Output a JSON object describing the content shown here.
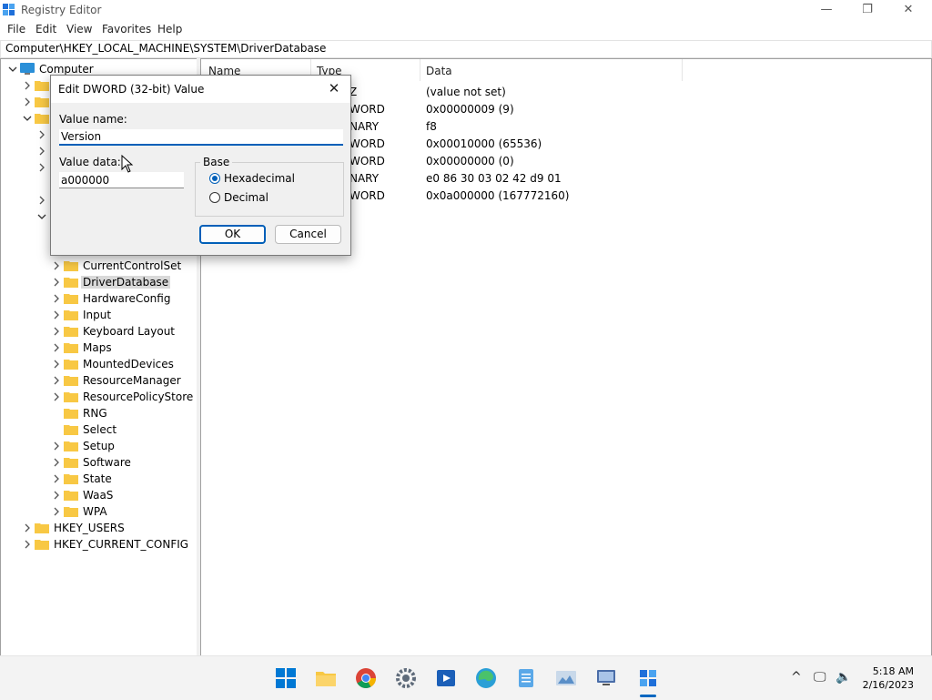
{
  "window": {
    "title": "Registry Editor",
    "controls": {
      "minimize": "—",
      "restore": "❐",
      "close": "✕"
    }
  },
  "menu": [
    "File",
    "Edit",
    "View",
    "Favorites",
    "Help"
  ],
  "address": "Computer\\HKEY_LOCAL_MACHINE\\SYSTEM\\DriverDatabase",
  "tree": {
    "root": "Computer",
    "system_children": [
      {
        "label": "CurrentControlSet",
        "selected": false
      },
      {
        "label": "DriverDatabase",
        "selected": true
      },
      {
        "label": "HardwareConfig",
        "selected": false
      },
      {
        "label": "Input",
        "selected": false
      },
      {
        "label": "Keyboard Layout",
        "selected": false
      },
      {
        "label": "Maps",
        "selected": false
      },
      {
        "label": "MountedDevices",
        "selected": false
      },
      {
        "label": "ResourceManager",
        "selected": false
      },
      {
        "label": "ResourcePolicyStore",
        "selected": false
      },
      {
        "label": "RNG",
        "selected": false
      },
      {
        "label": "Select",
        "selected": false
      },
      {
        "label": "Setup",
        "selected": false
      },
      {
        "label": "Software",
        "selected": false
      },
      {
        "label": "State",
        "selected": false
      },
      {
        "label": "WaaS",
        "selected": false
      },
      {
        "label": "WPA",
        "selected": false
      }
    ],
    "hives_after": [
      "HKEY_USERS",
      "HKEY_CURRENT_CONFIG"
    ]
  },
  "values": {
    "columns": {
      "name": "Name",
      "type": "Type",
      "data": "Data"
    },
    "rows": [
      {
        "type": "Z",
        "data": "(value not set)"
      },
      {
        "type": "WORD",
        "data": "0x00000009 (9)"
      },
      {
        "type": "NARY",
        "data": "f8"
      },
      {
        "type": "WORD",
        "data": "0x00010000 (65536)"
      },
      {
        "type": "WORD",
        "data": "0x00000000 (0)"
      },
      {
        "type": "NARY",
        "data": "e0 86 30 03 02 42 d9 01"
      },
      {
        "type": "WORD",
        "data": "0x0a000000 (167772160)"
      }
    ]
  },
  "dialog": {
    "title": "Edit DWORD (32-bit) Value",
    "close_glyph": "✕",
    "value_name_label": "Value name:",
    "value_name": "Version",
    "value_data_label": "Value data:",
    "value_data": "a000000",
    "base_label": "Base",
    "hex_label": "Hexadecimal",
    "dec_label": "Decimal",
    "base_selected": "Hexadecimal",
    "ok_label": "OK",
    "cancel_label": "Cancel"
  },
  "taskbar": {
    "apps": [
      "start-icon",
      "file-explorer-icon",
      "chrome-icon",
      "settings-icon",
      "media-player-icon",
      "edge-icon",
      "notepad-icon",
      "photos-icon",
      "remote-desktop-icon",
      "registry-editor-icon"
    ],
    "active_app": "registry-editor-icon",
    "tray": {
      "chevron": "^",
      "network": "🖵",
      "volume": "🔈"
    },
    "time": "5:18 AM",
    "date": "2/16/2023"
  },
  "colors": {
    "accent": "#005fb8",
    "folder": "#f8c844",
    "selection": "#d9d9d9"
  }
}
